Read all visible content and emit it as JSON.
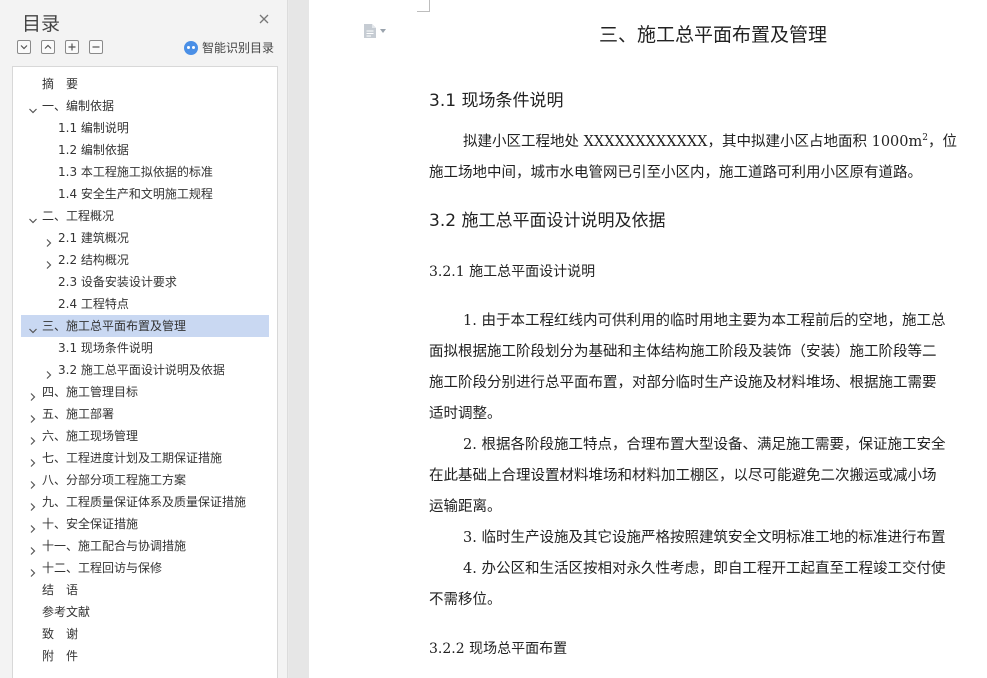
{
  "nav": {
    "title": "目录",
    "smart_label": "智能识别目录",
    "items": [
      {
        "label": "摘　要",
        "level": 0,
        "expand": "none",
        "selected": false
      },
      {
        "label": "一、编制依据",
        "level": 0,
        "expand": "open",
        "selected": false
      },
      {
        "label": "1.1 编制说明",
        "level": 1,
        "expand": "none",
        "selected": false
      },
      {
        "label": "1.2 编制依据",
        "level": 1,
        "expand": "none",
        "selected": false
      },
      {
        "label": "1.3 本工程施工拟依据的标准",
        "level": 1,
        "expand": "none",
        "selected": false
      },
      {
        "label": "1.4 安全生产和文明施工规程",
        "level": 1,
        "expand": "none",
        "selected": false
      },
      {
        "label": "二、工程概况",
        "level": 0,
        "expand": "open",
        "selected": false
      },
      {
        "label": "2.1 建筑概况",
        "level": 1,
        "expand": "closed",
        "selected": false
      },
      {
        "label": "2.2 结构概况",
        "level": 1,
        "expand": "closed",
        "selected": false
      },
      {
        "label": "2.3 设备安装设计要求",
        "level": 1,
        "expand": "none",
        "selected": false
      },
      {
        "label": "2.4 工程特点",
        "level": 1,
        "expand": "none",
        "selected": false
      },
      {
        "label": "三、施工总平面布置及管理",
        "level": 0,
        "expand": "open",
        "selected": true
      },
      {
        "label": "3.1 现场条件说明",
        "level": 1,
        "expand": "none",
        "selected": false
      },
      {
        "label": "3.2 施工总平面设计说明及依据",
        "level": 1,
        "expand": "closed",
        "selected": false
      },
      {
        "label": "四、施工管理目标",
        "level": 0,
        "expand": "closed",
        "selected": false
      },
      {
        "label": "五、施工部署",
        "level": 0,
        "expand": "closed",
        "selected": false
      },
      {
        "label": "六、施工现场管理",
        "level": 0,
        "expand": "closed",
        "selected": false
      },
      {
        "label": "七、工程进度计划及工期保证措施",
        "level": 0,
        "expand": "closed",
        "selected": false
      },
      {
        "label": "八、分部分项工程施工方案",
        "level": 0,
        "expand": "closed",
        "selected": false
      },
      {
        "label": "九、工程质量保证体系及质量保证措施",
        "level": 0,
        "expand": "closed",
        "selected": false
      },
      {
        "label": "十、安全保证措施",
        "level": 0,
        "expand": "closed",
        "selected": false
      },
      {
        "label": "十一、施工配合与协调措施",
        "level": 0,
        "expand": "closed",
        "selected": false
      },
      {
        "label": "十二、工程回访与保修",
        "level": 0,
        "expand": "closed",
        "selected": false
      },
      {
        "label": "结　语",
        "level": 0,
        "expand": "none",
        "selected": false
      },
      {
        "label": "参考文献",
        "level": 0,
        "expand": "none",
        "selected": false
      },
      {
        "label": "致　谢",
        "level": 0,
        "expand": "none",
        "selected": false
      },
      {
        "label": "附　件",
        "level": 0,
        "expand": "none",
        "selected": false
      }
    ]
  },
  "doc": {
    "title": "三、施工总平面布置及管理",
    "s31_heading": "3.1  现场条件说明",
    "s31_p1_a": "拟建小区工程地处 XXXXXXXXXXXX，其中拟建小区占地面积 1000m",
    "s31_p1_sup": "2",
    "s31_p1_b": "，位",
    "s31_p2": "施工场地中间，城市水电管网已引至小区内，施工道路可利用小区原有道路。",
    "s32_heading": "3.2  施工总平面设计说明及依据",
    "s321_heading": "3.2.1 施工总平面设计说明",
    "lines": [
      {
        "text": "1. 由于本工程红线内可供利用的临时用地主要为本工程前后的空地，施工总",
        "indent": true
      },
      {
        "text": "面拟根据施工阶段划分为基础和主体结构施工阶段及装饰（安装）施工阶段等二",
        "indent": false
      },
      {
        "text": "施工阶段分别进行总平面布置，对部分临时生产设施及材料堆场、根据施工需要",
        "indent": false
      },
      {
        "text": "适时调整。",
        "indent": false
      },
      {
        "text": "2. 根据各阶段施工特点，合理布置大型设备、满足施工需要，保证施工安全",
        "indent": true
      },
      {
        "text": "在此基础上合理设置材料堆场和材料加工棚区，以尽可能避免二次搬运或减小场",
        "indent": false
      },
      {
        "text": "运输距离。",
        "indent": false
      },
      {
        "text": "3. 临时生产设施及其它设施严格按照建筑安全文明标准工地的标准进行布置",
        "indent": true
      },
      {
        "text": "4. 办公区和生活区按相对永久性考虑，即自工程开工起直至工程竣工交付使",
        "indent": true
      },
      {
        "text": "不需移位。",
        "indent": false
      }
    ],
    "s322_heading": "3.2.2  现场总平面布置"
  }
}
